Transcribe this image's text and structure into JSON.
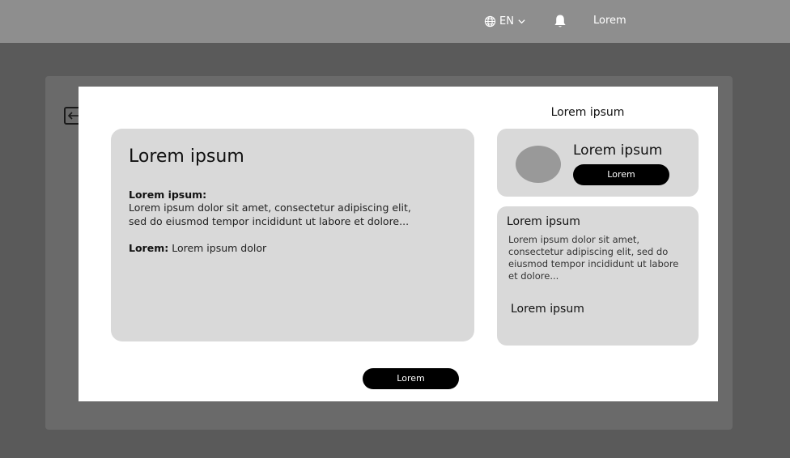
{
  "topbar": {
    "language_code": "EN",
    "user_label": "Lorem"
  },
  "modal": {
    "main_card": {
      "title": "Lorem ipsum",
      "label": "Lorem ipsum:",
      "description": "Lorem ipsum dolor sit amet, consectetur adipiscing elit, sed do eiusmod tempor incididunt ut labore et dolore...",
      "meta_label": "Lorem:",
      "meta_value": "Lorem ipsum dolor"
    },
    "side_heading": "Lorem ipsum",
    "profile_card": {
      "name": "Lorem ipsum",
      "button_label": "Lorem"
    },
    "info_card": {
      "title": "Lorem ipsum",
      "description": "Lorem ipsum dolor sit amet, consectetur adipiscing elit, sed do eiusmod tempor incididunt ut labore et dolore...",
      "subtitle": "Lorem ipsum"
    },
    "footer_button_label": "Lorem"
  },
  "icons": [
    "globe-icon",
    "chevron-down-icon",
    "bell-icon",
    "arrow-left-icon"
  ],
  "colors": {
    "topbar": "#8e8e8e",
    "overlay": "#5a5a5a",
    "card": "#d9d9d9",
    "avatar": "#999999",
    "button": "#000000"
  }
}
